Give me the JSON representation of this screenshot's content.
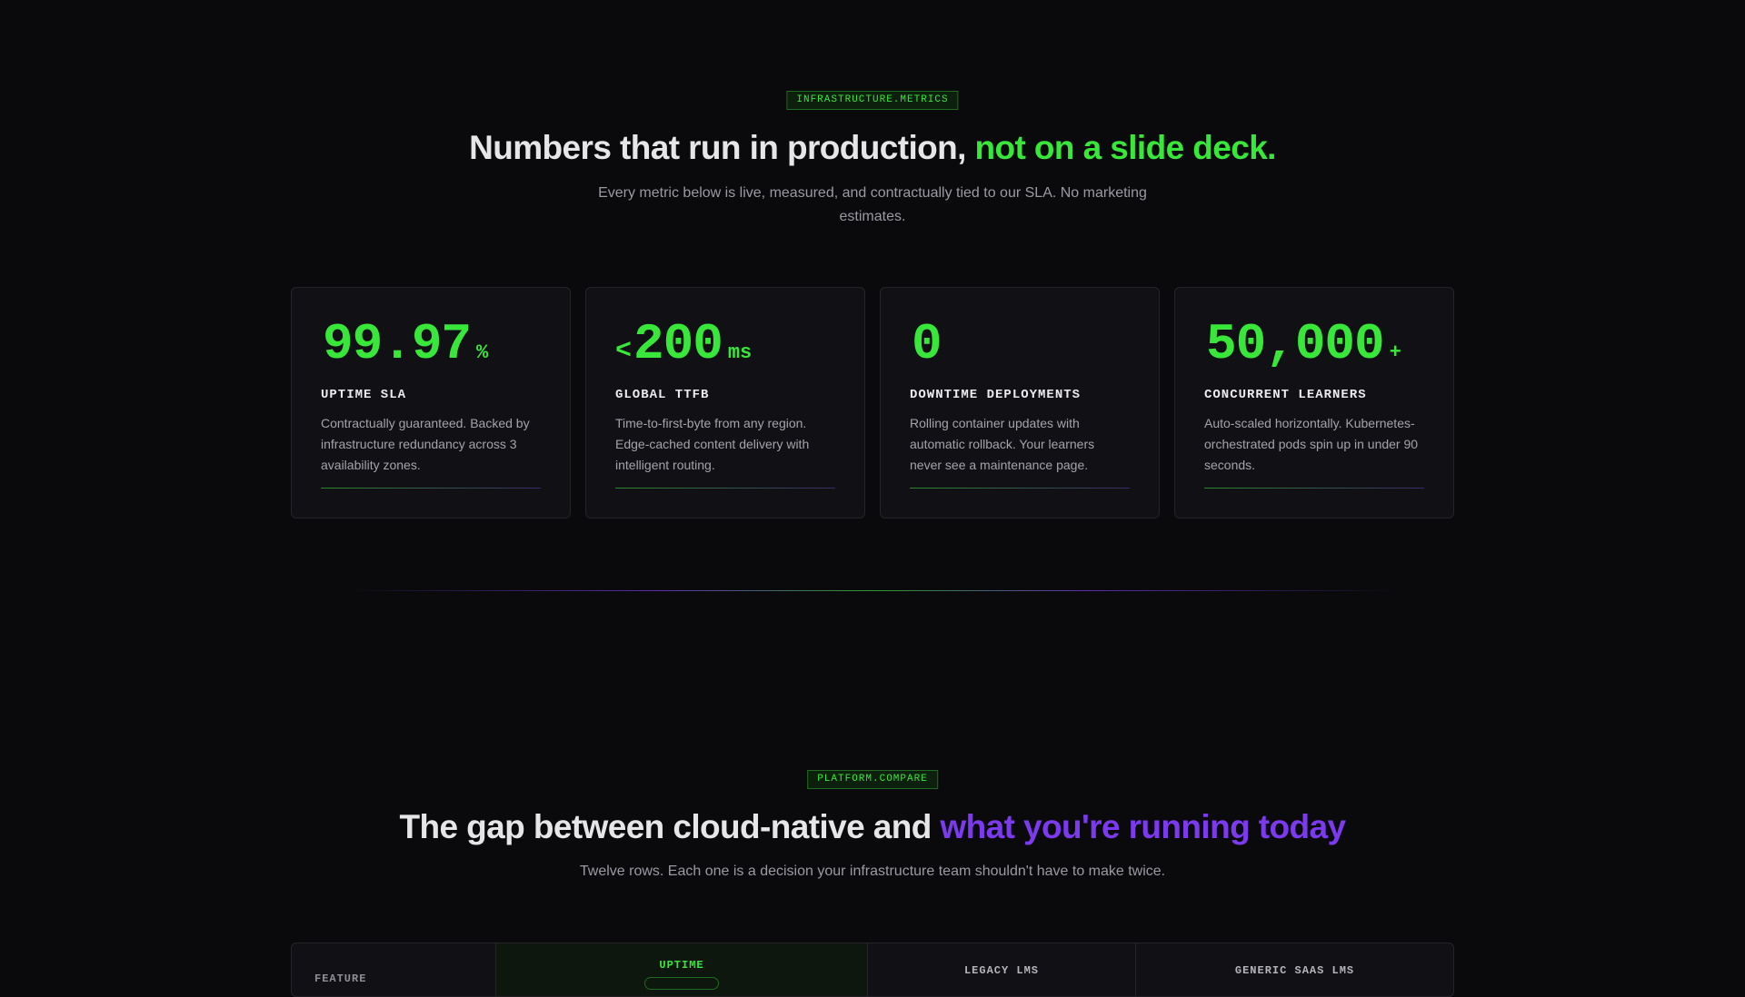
{
  "metrics_section": {
    "tag": "INFRASTRUCTURE.METRICS",
    "headline_main": "Numbers that run in production,",
    "headline_accent": "not on a slide deck.",
    "subcopy": "Every metric below is live, measured, and contractually tied to our SLA. No marketing estimates.",
    "cards": [
      {
        "prefix": "",
        "value": "99.97",
        "suffix": "%",
        "label": "UPTIME SLA",
        "description": "Contractually guaranteed. Backed by infrastructure redundancy across 3 availability zones."
      },
      {
        "prefix": "<",
        "value": "200",
        "suffix": "ms",
        "label": "GLOBAL TTFB",
        "description": "Time-to-first-byte from any region. Edge-cached content delivery with intelligent routing."
      },
      {
        "prefix": "",
        "value": "0",
        "suffix": "",
        "label": "DOWNTIME DEPLOYMENTS",
        "description": "Rolling container updates with automatic rollback. Your learners never see a maintenance page."
      },
      {
        "prefix": "",
        "value": "50,000",
        "suffix": "+",
        "label": "CONCURRENT LEARNERS",
        "description": "Auto-scaled horizontally. Kubernetes-orchestrated pods spin up in under 90 seconds."
      }
    ]
  },
  "compare_section": {
    "tag": "PLATFORM.COMPARE",
    "headline_main": "The gap between cloud-native and",
    "headline_accent": "what you're running today",
    "subcopy": "Twelve rows. Each one is a decision your infrastructure team shouldn't have to make twice.",
    "columns": {
      "feature": "FEATURE",
      "uptime": "UPTIME",
      "legacy": "LEGACY LMS",
      "generic": "GENERIC SAAS LMS"
    }
  },
  "colors": {
    "accent_green": "#39e63a",
    "accent_purple": "#7b3aed",
    "background": "#0a0a0d",
    "card_background": "#111115"
  }
}
